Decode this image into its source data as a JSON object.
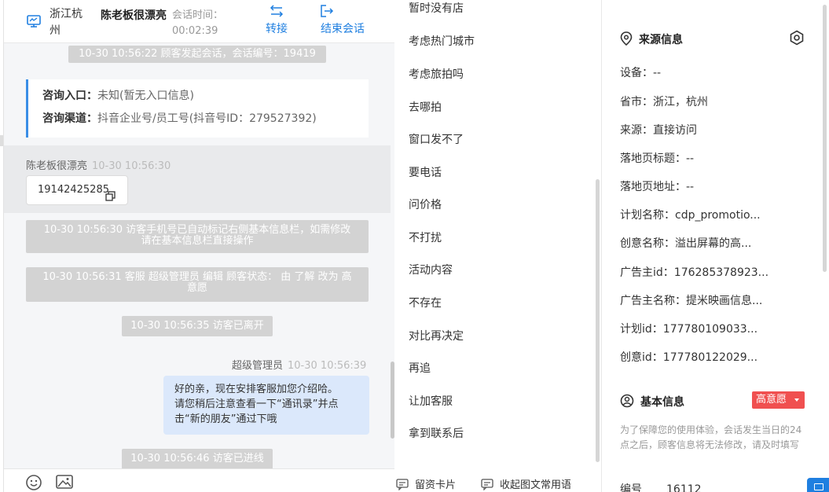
{
  "header": {
    "location": "浙江杭州",
    "customer_name": "陈老板很漂亮",
    "session_time_label": "会话时间：",
    "session_time": "00:02:39",
    "transfer_label": "转接",
    "end_session_label": "结束会话"
  },
  "chat": {
    "system_start": "10-30 10:56:22 顾客发起会话，会话编号：19419",
    "entry_label": "咨询入口：",
    "entry_value": "未知(暂无入口信息)",
    "channel_label": "咨询渠道：",
    "channel_value": "抖音企业号/员工号(抖音号ID：279527392)",
    "customer_name": "陈老板很漂亮",
    "customer_time": "10-30 10:56:30",
    "customer_message": "19142425285",
    "system_phone_line1": "10-30 10:56:30 访客手机号已自动标记右侧基本信息栏，如需修改",
    "system_phone_line2": "请在基本信息栏直接操作",
    "system_status_line1": "10-30 10:56:31 客服 超级管理员 编辑 顾客状态： 由 了解 改为 高",
    "system_status_line2": "意愿",
    "system_left": "10-30 10:56:35 访客已离开",
    "agent_name": "超级管理员",
    "agent_time": "10-30 10:56:39",
    "agent_message_line1": "好的亲，现在安排客服加您介绍哈。",
    "agent_message_line2": "请您稍后注意查看一下“通讯录”并点",
    "agent_message_line3": "击“新的朋友”通过下哦",
    "system_enter": "10-30 10:56:46 访客已进线"
  },
  "icons": {
    "monitor": "monitor-icon",
    "transfer": "transfer-arrows-icon",
    "exit": "exit-icon",
    "copy": "copy-icon",
    "emoji": "emoji-icon",
    "image": "image-icon",
    "location": "location-pin-icon",
    "gear": "gear-icon",
    "user": "user-circle-icon",
    "card": "card-icon"
  },
  "quick_phrases": [
    "暂时没有店",
    "考虑热门城市",
    "考虑旅拍吗",
    "去哪拍",
    "窗口发不了",
    "要电话",
    "问价格",
    "不打扰",
    "活动内容",
    "不存在",
    "对比再决定",
    "再追",
    "让加客服",
    "拿到联系后"
  ],
  "quick_footer": {
    "leave_card_label": "留资卡片",
    "collapse_label": "收起图文常用语"
  },
  "source_info": {
    "title": "来源信息",
    "rows": [
      {
        "label": "设备：",
        "value": "--"
      },
      {
        "label": "省市：",
        "value": "浙江，杭州"
      },
      {
        "label": "来源：",
        "value": "直接访问"
      },
      {
        "label": "落地页标题：",
        "value": "--"
      },
      {
        "label": "落地页地址：",
        "value": "--"
      },
      {
        "label": "计划名称：",
        "value": "cdp_promotio..."
      },
      {
        "label": "创意名称：",
        "value": "溢出屏幕的高..."
      },
      {
        "label": "广告主id：",
        "value": "176285378923..."
      },
      {
        "label": "广告主名称：",
        "value": "提米映画信息..."
      },
      {
        "label": "计划id：",
        "value": "177780109033..."
      },
      {
        "label": "创意id：",
        "value": "177780122029..."
      }
    ]
  },
  "basic_info": {
    "title": "基本信息",
    "intent_badge": "高意愿",
    "note": "为了保障您的使用体验，会话发生当日的24点之后，顾客信息将无法修改，请及时填写",
    "number_label": "编号",
    "number_value": "16112"
  },
  "colors": {
    "accent": "#1f7fe0",
    "system_bubble": "#d3d3d3",
    "agent_bubble": "#dbe8fb",
    "badge_red": "#f05050"
  }
}
